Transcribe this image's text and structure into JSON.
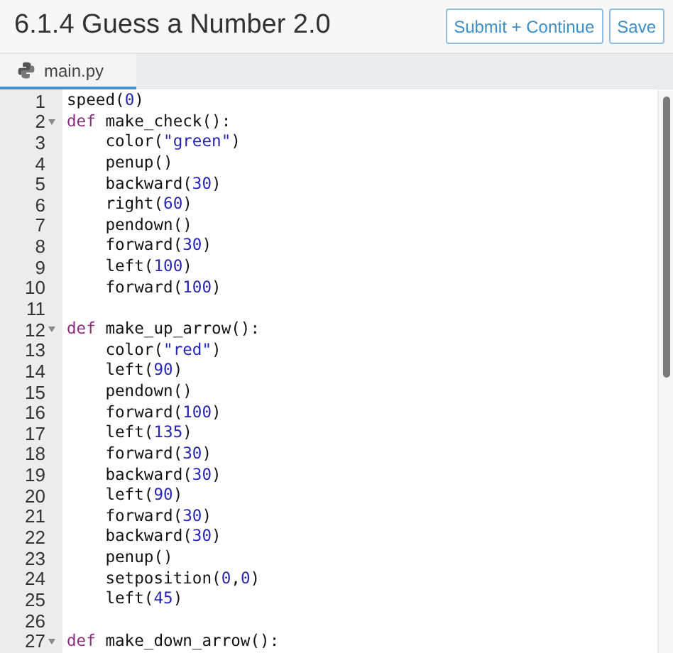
{
  "header": {
    "title": "6.1.4 Guess a Number 2.0",
    "buttons": [
      "Submit + Continue",
      "Save"
    ]
  },
  "tabs": [
    {
      "label": "main.py",
      "selected": true
    }
  ],
  "editor": {
    "lines": [
      {
        "number": "1",
        "foldable": false,
        "tokens": [
          {
            "kind": "plain",
            "text": "speed("
          },
          {
            "kind": "number",
            "text": "0"
          },
          {
            "kind": "plain",
            "text": ")"
          }
        ]
      },
      {
        "number": "2",
        "foldable": true,
        "tokens": [
          {
            "kind": "keyword",
            "text": "def"
          },
          {
            "kind": "plain",
            "text": " make_check():"
          }
        ]
      },
      {
        "number": "3",
        "foldable": false,
        "tokens": [
          {
            "kind": "plain",
            "text": "    color("
          },
          {
            "kind": "string",
            "text": "\"green\""
          },
          {
            "kind": "plain",
            "text": ")"
          }
        ]
      },
      {
        "number": "4",
        "foldable": false,
        "tokens": [
          {
            "kind": "plain",
            "text": "    penup()"
          }
        ]
      },
      {
        "number": "5",
        "foldable": false,
        "tokens": [
          {
            "kind": "plain",
            "text": "    backward("
          },
          {
            "kind": "number",
            "text": "30"
          },
          {
            "kind": "plain",
            "text": ")"
          }
        ]
      },
      {
        "number": "6",
        "foldable": false,
        "tokens": [
          {
            "kind": "plain",
            "text": "    right("
          },
          {
            "kind": "number",
            "text": "60"
          },
          {
            "kind": "plain",
            "text": ")"
          }
        ]
      },
      {
        "number": "7",
        "foldable": false,
        "tokens": [
          {
            "kind": "plain",
            "text": "    pendown()"
          }
        ]
      },
      {
        "number": "8",
        "foldable": false,
        "tokens": [
          {
            "kind": "plain",
            "text": "    forward("
          },
          {
            "kind": "number",
            "text": "30"
          },
          {
            "kind": "plain",
            "text": ")"
          }
        ]
      },
      {
        "number": "9",
        "foldable": false,
        "tokens": [
          {
            "kind": "plain",
            "text": "    left("
          },
          {
            "kind": "number",
            "text": "100"
          },
          {
            "kind": "plain",
            "text": ")"
          }
        ]
      },
      {
        "number": "10",
        "foldable": false,
        "tokens": [
          {
            "kind": "plain",
            "text": "    forward("
          },
          {
            "kind": "number",
            "text": "100"
          },
          {
            "kind": "plain",
            "text": ")"
          }
        ]
      },
      {
        "number": "11",
        "foldable": false
      },
      {
        "number": "12",
        "foldable": true,
        "tokens": [
          {
            "kind": "keyword",
            "text": "def"
          },
          {
            "kind": "plain",
            "text": " make_up_arrow():"
          }
        ]
      },
      {
        "number": "13",
        "foldable": false,
        "tokens": [
          {
            "kind": "plain",
            "text": "    color("
          },
          {
            "kind": "string",
            "text": "\"red\""
          },
          {
            "kind": "plain",
            "text": ")"
          }
        ]
      },
      {
        "number": "14",
        "foldable": false,
        "tokens": [
          {
            "kind": "plain",
            "text": "    left("
          },
          {
            "kind": "number",
            "text": "90"
          },
          {
            "kind": "plain",
            "text": ")"
          }
        ]
      },
      {
        "number": "15",
        "foldable": false,
        "tokens": [
          {
            "kind": "plain",
            "text": "    pendown()"
          }
        ]
      },
      {
        "number": "16",
        "foldable": false,
        "tokens": [
          {
            "kind": "plain",
            "text": "    forward("
          },
          {
            "kind": "number",
            "text": "100"
          },
          {
            "kind": "plain",
            "text": ")"
          }
        ]
      },
      {
        "number": "17",
        "foldable": false,
        "tokens": [
          {
            "kind": "plain",
            "text": "    left("
          },
          {
            "kind": "number",
            "text": "135"
          },
          {
            "kind": "plain",
            "text": ")"
          }
        ]
      },
      {
        "number": "18",
        "foldable": false,
        "tokens": [
          {
            "kind": "plain",
            "text": "    forward("
          },
          {
            "kind": "number",
            "text": "30"
          },
          {
            "kind": "plain",
            "text": ")"
          }
        ]
      },
      {
        "number": "19",
        "foldable": false,
        "tokens": [
          {
            "kind": "plain",
            "text": "    backward("
          },
          {
            "kind": "number",
            "text": "30"
          },
          {
            "kind": "plain",
            "text": ")"
          }
        ]
      },
      {
        "number": "20",
        "foldable": false,
        "tokens": [
          {
            "kind": "plain",
            "text": "    left("
          },
          {
            "kind": "number",
            "text": "90"
          },
          {
            "kind": "plain",
            "text": ")"
          }
        ]
      },
      {
        "number": "21",
        "foldable": false,
        "tokens": [
          {
            "kind": "plain",
            "text": "    forward("
          },
          {
            "kind": "number",
            "text": "30"
          },
          {
            "kind": "plain",
            "text": ")"
          }
        ]
      },
      {
        "number": "22",
        "foldable": false,
        "tokens": [
          {
            "kind": "plain",
            "text": "    backward("
          },
          {
            "kind": "number",
            "text": "30"
          },
          {
            "kind": "plain",
            "text": ")"
          }
        ]
      },
      {
        "number": "23",
        "foldable": false,
        "tokens": [
          {
            "kind": "plain",
            "text": "    penup()"
          }
        ]
      },
      {
        "number": "24",
        "foldable": false,
        "tokens": [
          {
            "kind": "plain",
            "text": "    setposition("
          },
          {
            "kind": "number",
            "text": "0"
          },
          {
            "kind": "plain",
            "text": ","
          },
          {
            "kind": "number",
            "text": "0"
          },
          {
            "kind": "plain",
            "text": ")"
          }
        ]
      },
      {
        "number": "25",
        "foldable": false,
        "tokens": [
          {
            "kind": "plain",
            "text": "    left("
          },
          {
            "kind": "number",
            "text": "45"
          },
          {
            "kind": "plain",
            "text": ")"
          }
        ]
      },
      {
        "number": "26",
        "foldable": false
      },
      {
        "number": "27",
        "foldable": true,
        "tokens": [
          {
            "kind": "keyword",
            "text": "def"
          },
          {
            "kind": "plain",
            "text": " make_down_arrow():"
          }
        ]
      }
    ]
  }
}
